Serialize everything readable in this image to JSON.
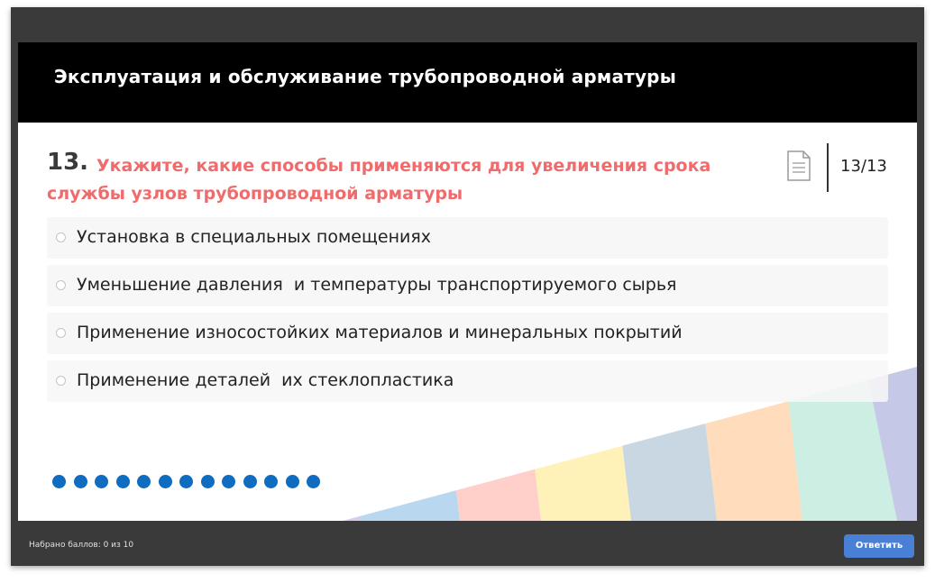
{
  "course": {
    "title": "Эксплуатация и обслуживание трубопроводной арматуры"
  },
  "question": {
    "number": "13.",
    "text": "Укажите, какие способы применяются для увеличения срока службы узлов трубопроводной арматуры",
    "counter": "13/13",
    "text_color": "#f06b6b"
  },
  "options": [
    {
      "label": "Установка в специальных помещениях"
    },
    {
      "label": "Уменьшение давления  и температуры транспортируемого сырья"
    },
    {
      "label": "Применение износостойких материалов и минеральных покрытий"
    },
    {
      "label": "Применение деталей  их стеклопластика"
    }
  ],
  "progress": {
    "total_dots": 13,
    "dot_color": "#0f6cc0"
  },
  "footer": {
    "score_text": "Набрано баллов: 0 из 10",
    "answer_button": "Ответить",
    "button_color": "#4a7fd6"
  },
  "icons": {
    "document": "document-icon",
    "radio": "radio-icon"
  }
}
